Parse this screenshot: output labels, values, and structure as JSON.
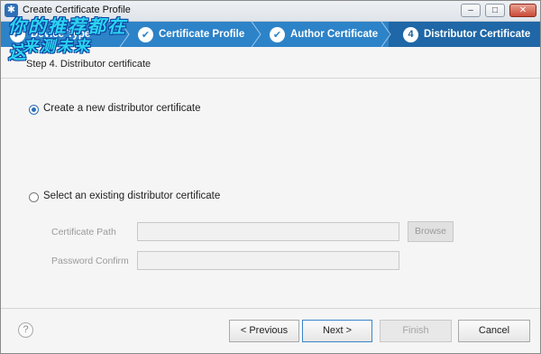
{
  "window": {
    "title": "Create Certificate Profile",
    "controls": {
      "minimize": "–",
      "maximize": "□",
      "close": "✕"
    }
  },
  "watermark": {
    "line1": "你的推荐都在这",
    "line2": "来测未来"
  },
  "steps": [
    {
      "number": "",
      "label": "Device Type",
      "state": "done"
    },
    {
      "number": "",
      "label": "Certificate Profile",
      "state": "done"
    },
    {
      "number": "",
      "label": "Author Certificate",
      "state": "done"
    },
    {
      "number": "4",
      "label": "Distributor Certificate",
      "state": "active"
    }
  ],
  "step_title": "Step 4. Distributor certificate",
  "options": {
    "create_new": {
      "label": "Create a new distributor certificate",
      "checked": true
    },
    "select_existing": {
      "label": "Select an existing distributor certificate",
      "checked": false
    }
  },
  "fields": {
    "certificate_path": {
      "label": "Certificate Path",
      "value": ""
    },
    "password_confirm": {
      "label": "Password Confirm",
      "value": ""
    }
  },
  "buttons": {
    "browse": "Browse",
    "help": "?",
    "previous": "< Previous",
    "next": "Next >",
    "finish": "Finish",
    "cancel": "Cancel"
  },
  "colors": {
    "step_bar": "#2d83c8",
    "step_active": "#1f67a6"
  }
}
